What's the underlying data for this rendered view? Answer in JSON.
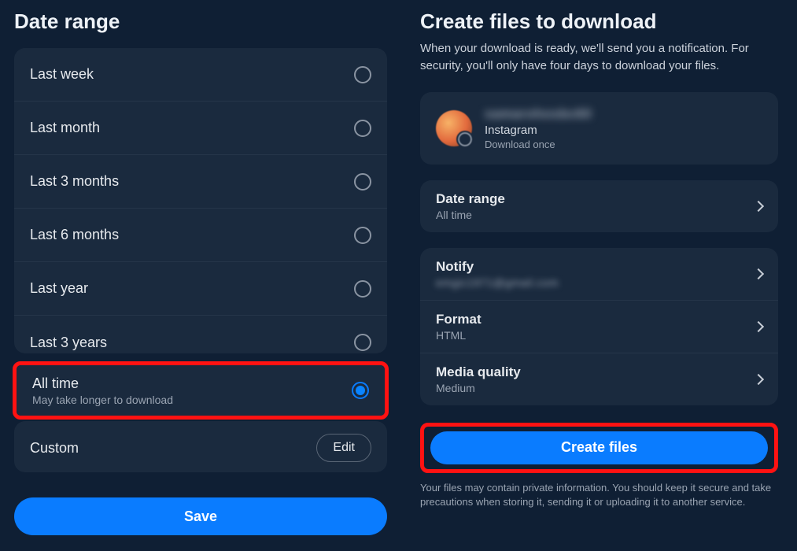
{
  "left": {
    "title": "Date range",
    "options": [
      {
        "label": "Last week"
      },
      {
        "label": "Last month"
      },
      {
        "label": "Last 3 months"
      },
      {
        "label": "Last 6 months"
      },
      {
        "label": "Last year"
      },
      {
        "label": "Last 3 years"
      }
    ],
    "selected": {
      "label": "All time",
      "sub": "May take longer to download"
    },
    "custom": {
      "label": "Custom",
      "edit": "Edit"
    },
    "save": "Save"
  },
  "right": {
    "title": "Create files to download",
    "subtitle": "When your download is ready, we'll send you a notification. For security, you'll only have four days to download your files.",
    "profile": {
      "username_masked": "samarohosbc60",
      "platform": "Instagram",
      "download_mode": "Download once"
    },
    "date_range": {
      "label": "Date range",
      "value": "All time"
    },
    "notify": {
      "label": "Notify",
      "value_masked": "emgic1971@gmail.com"
    },
    "format": {
      "label": "Format",
      "value": "HTML"
    },
    "media_quality": {
      "label": "Media quality",
      "value": "Medium"
    },
    "create_button": "Create files",
    "disclaimer": "Your files may contain private information. You should keep it secure and take precautions when storing it, sending it or uploading it to another service."
  }
}
